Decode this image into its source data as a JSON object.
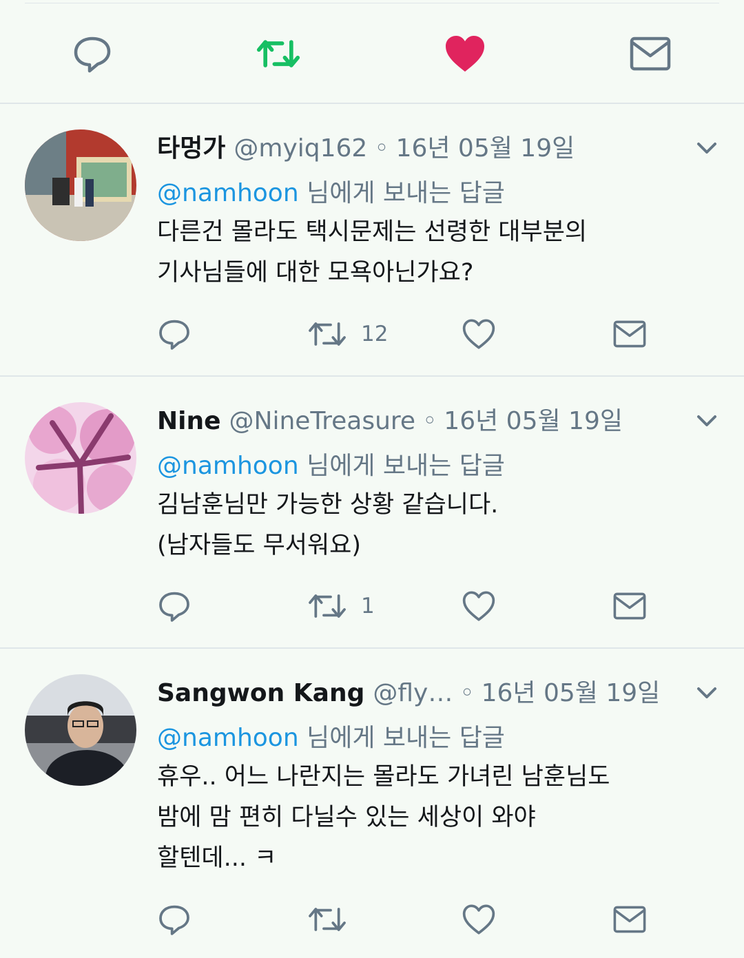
{
  "colors": {
    "background": "#f5faf5",
    "retweet_active": "#17bf63",
    "like_active": "#e0245e",
    "icon_gray": "#657786",
    "mention_blue": "#1b95e0"
  },
  "top_actions": {
    "reply_icon": "reply-icon",
    "retweet_icon": "retweet-icon",
    "retweet_active": true,
    "like_icon": "heart-icon",
    "like_active": true,
    "message_icon": "envelope-icon"
  },
  "tweets": [
    {
      "name": "타멍가",
      "handle": "@myiq162",
      "separator": "◦",
      "date": "16년 05월 19일",
      "reply_prefix": "@namhoon",
      "reply_suffix": " 님에게 보내는 답글",
      "body": [
        "다른건 몰라도 택시문제는 선령한 대부분의",
        "기사님들에 대한 모욕아닌가요?"
      ],
      "retweet_count": "12",
      "like_count": ""
    },
    {
      "name": "Nine",
      "handle": "@NineTreasure",
      "separator": "◦",
      "date": "16년 05월 19일",
      "reply_prefix": "@namhoon",
      "reply_suffix": " 님에게 보내는 답글",
      "body": [
        "김남훈님만 가능한 상황 같습니다.",
        "(남자들도 무서워요)"
      ],
      "retweet_count": "1",
      "like_count": ""
    },
    {
      "name": "Sangwon Kang",
      "handle": "@fly…",
      "separator": "◦",
      "date": "16년 05월 19일",
      "reply_prefix": "@namhoon",
      "reply_suffix": " 님에게 보내는 답글",
      "body": [
        "휴우.. 어느 나란지는 몰라도 가녀린 남훈님도",
        "밤에 맘 편히 다닐수 있는 세상이 와야",
        "할텐데... ㅋ"
      ],
      "retweet_count": "",
      "like_count": ""
    }
  ]
}
